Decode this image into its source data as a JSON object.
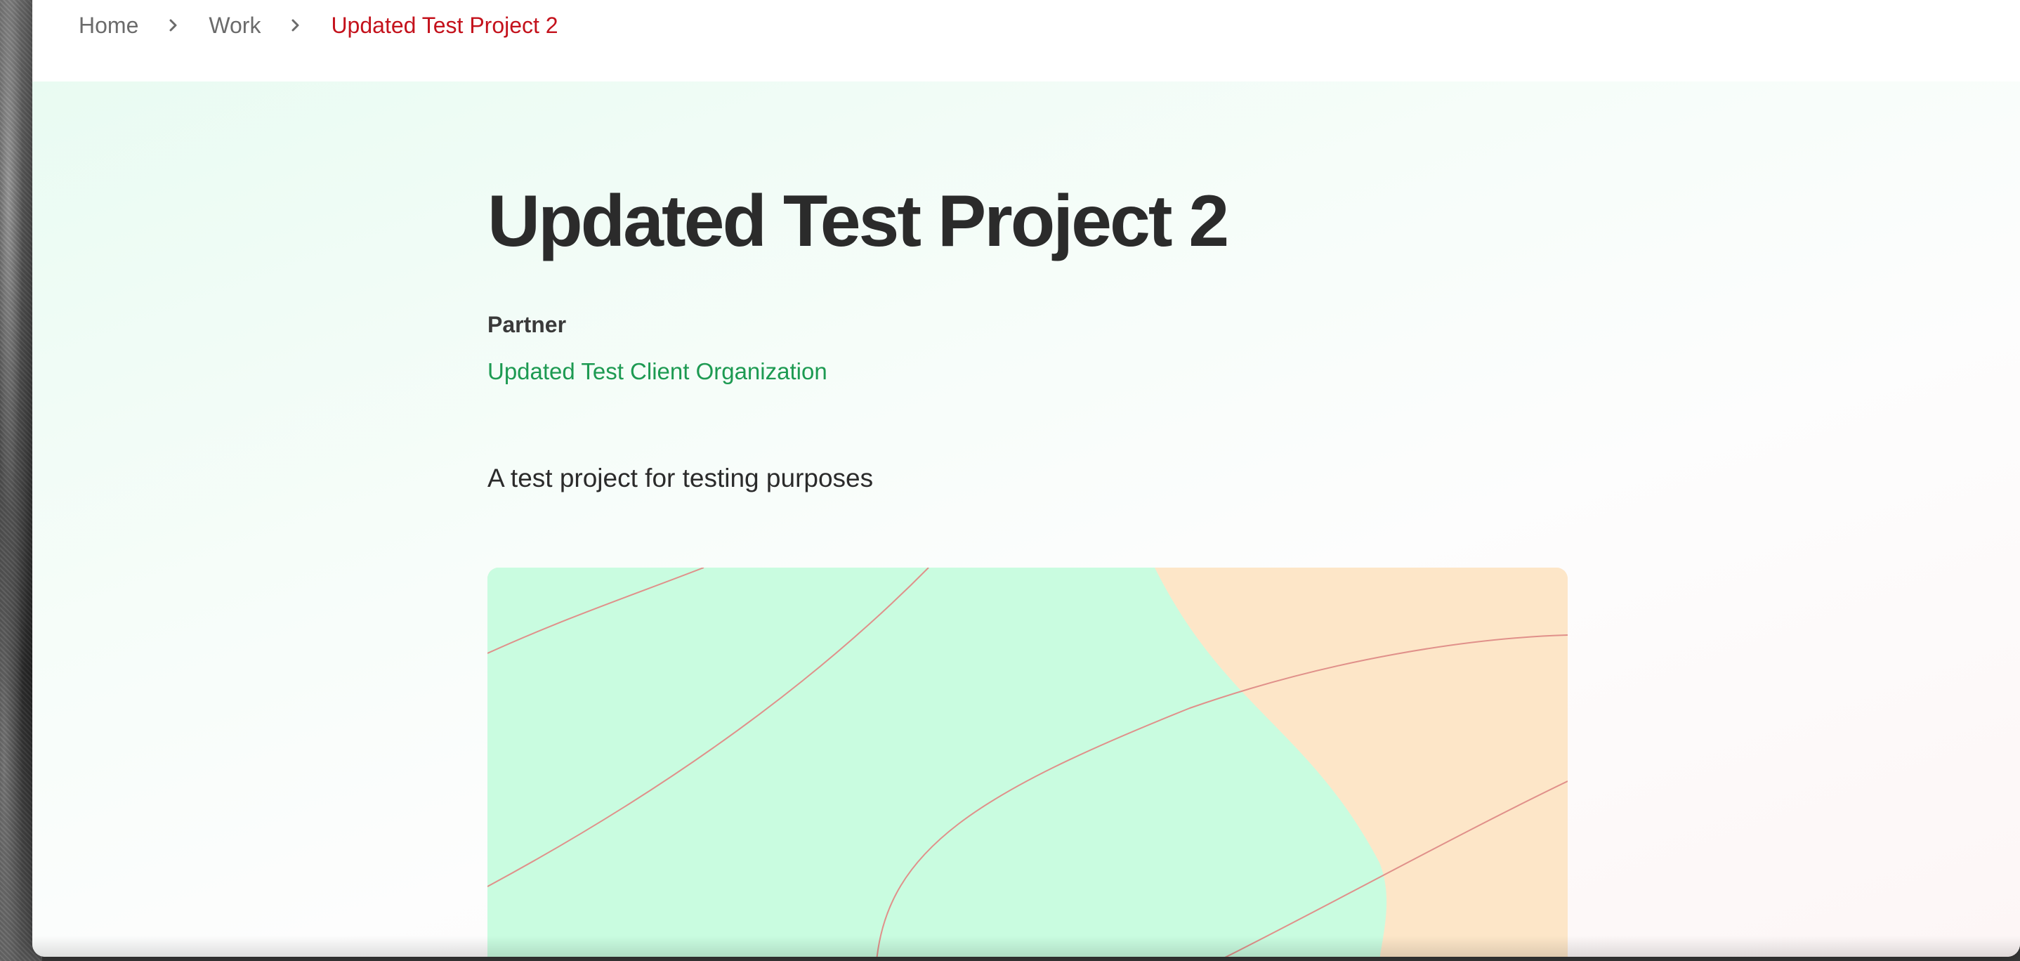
{
  "breadcrumb": {
    "items": [
      {
        "label": "Home"
      },
      {
        "label": "Work"
      },
      {
        "label": "Updated Test Project 2"
      }
    ]
  },
  "project": {
    "title": "Updated Test Project 2",
    "partner_label": "Partner",
    "partner_name": "Updated Test Client Organization",
    "description": "A test project for testing purposes"
  },
  "colors": {
    "accent_red": "#c4121c",
    "partner_green": "#1d9a52",
    "image_mint": "#c9fce0",
    "image_peach": "#fde6c8",
    "image_lines": "#e0908a"
  }
}
